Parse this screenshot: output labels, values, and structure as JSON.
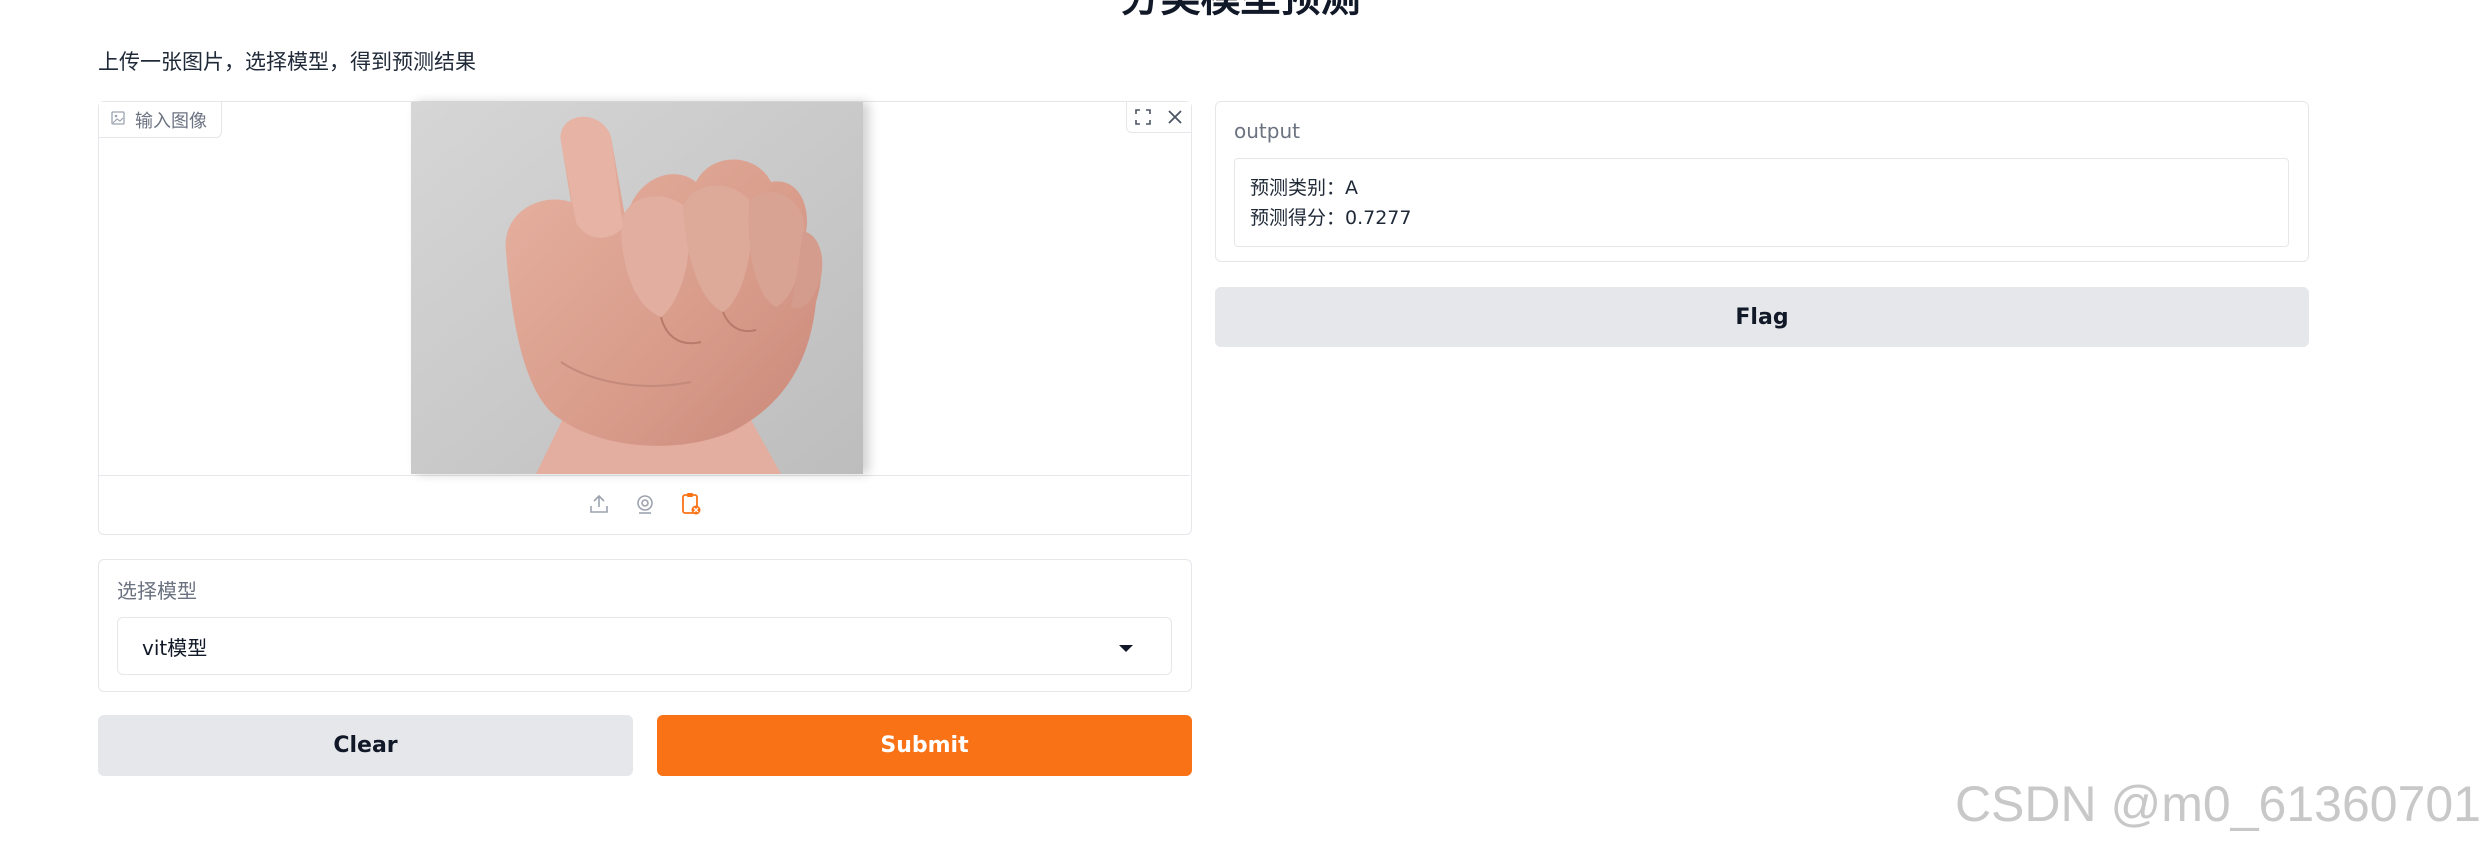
{
  "header": {
    "title": "分类模型预测",
    "description": "上传一张图片，选择模型，得到预测结果"
  },
  "image_input": {
    "label": "输入图像",
    "label_icon": "image-icon",
    "controls": [
      "fullscreen-icon",
      "close-icon"
    ],
    "sources": [
      "upload-icon",
      "webcam-icon",
      "clipboard-icon"
    ]
  },
  "model_select": {
    "label": "选择模型",
    "value": "vit模型"
  },
  "actions": {
    "clear": "Clear",
    "submit": "Submit",
    "flag": "Flag"
  },
  "output": {
    "label": "output",
    "line1": "预测类别：A",
    "line2": "预测得分：0.7277"
  },
  "watermark": "CSDN @m0_61360701",
  "colors": {
    "accent": "#f97316",
    "secondary_button": "#e5e7eb",
    "border": "#e5e7eb",
    "muted_text": "#6b7280"
  }
}
